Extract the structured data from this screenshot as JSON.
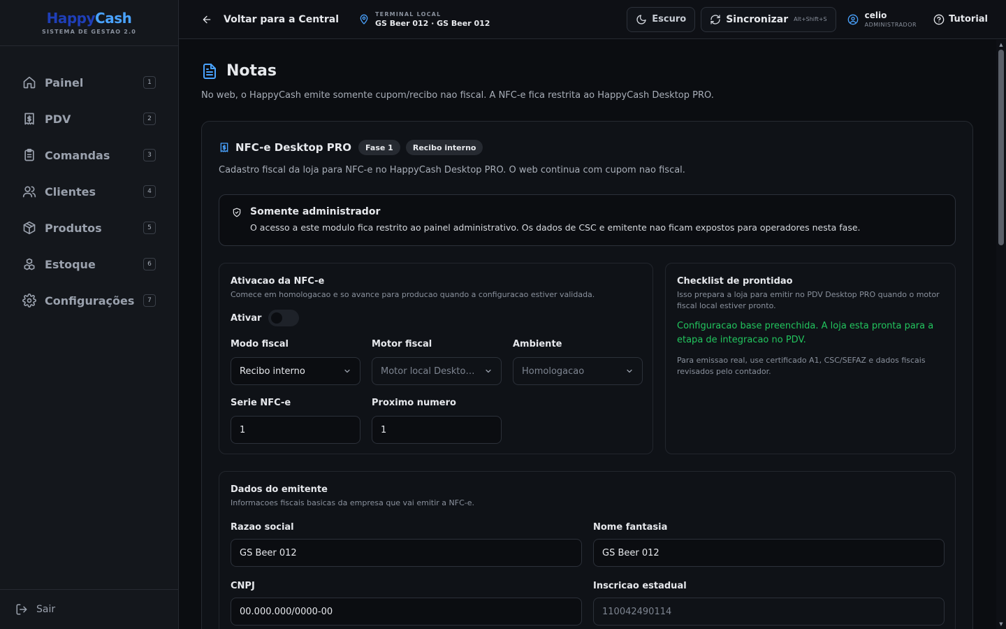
{
  "brand": {
    "happy": "Happy",
    "cash": "Cash",
    "subtitle": "SISTEMA DE GESTAO 2.0"
  },
  "sidebar": {
    "items": [
      {
        "label": "Painel",
        "key": "1",
        "icon": "home-icon"
      },
      {
        "label": "PDV",
        "key": "2",
        "icon": "receipt-icon"
      },
      {
        "label": "Comandas",
        "key": "3",
        "icon": "clipboard-icon"
      },
      {
        "label": "Clientes",
        "key": "4",
        "icon": "users-icon"
      },
      {
        "label": "Produtos",
        "key": "5",
        "icon": "package-icon"
      },
      {
        "label": "Estoque",
        "key": "6",
        "icon": "boxes-icon"
      },
      {
        "label": "Configurações",
        "key": "7",
        "icon": "gear-icon"
      }
    ],
    "logout": "Sair"
  },
  "header": {
    "back": "Voltar para a Central",
    "terminal_label": "TERMINAL LOCAL",
    "terminal_value": "GS Beer 012 · GS Beer 012",
    "theme": "Escuro",
    "sync": "Sincronizar",
    "sync_shortcut": "Alt+Shift+S",
    "user_name": "celio",
    "user_role": "ADMINISTRADOR",
    "tutorial": "Tutorial"
  },
  "page": {
    "title": "Notas",
    "description": "No web, o HappyCash emite somente cupom/recibo nao fiscal. A NFC-e fica restrita ao HappyCash Desktop PRO."
  },
  "card": {
    "title": "NFC-e Desktop PRO",
    "badge_phase": "Fase 1",
    "badge_mode": "Recibo interno",
    "description": "Cadastro fiscal da loja para NFC-e no HappyCash Desktop PRO. O web continua com cupom nao fiscal.",
    "alert_title": "Somente administrador",
    "alert_text": "O acesso a este modulo fica restrito ao painel administrativo. Os dados de CSC e emitente nao ficam expostos para operadores nesta fase."
  },
  "activation": {
    "title": "Ativacao da NFC-e",
    "subtitle": "Comece em homologacao e so avance para producao quando a configuracao estiver validada.",
    "toggle_label": "Ativar",
    "toggle_on": false,
    "modo_label": "Modo fiscal",
    "modo_value": "Recibo interno",
    "motor_label": "Motor fiscal",
    "motor_value": "Motor local Desktop PRO",
    "ambiente_label": "Ambiente",
    "ambiente_value": "Homologacao",
    "serie_label": "Serie NFC-e",
    "serie_value": "1",
    "numero_label": "Proximo numero",
    "numero_value": "1"
  },
  "checklist": {
    "title": "Checklist de prontidao",
    "subtitle": "Isso prepara a loja para emitir no PDV Desktop PRO quando o motor fiscal local estiver pronto.",
    "status": "Configuracao base preenchida. A loja esta pronta para a etapa de integracao no PDV.",
    "note": "Para emissao real, use certificado A1, CSC/SEFAZ e dados fiscais revisados pelo contador."
  },
  "emitente": {
    "title": "Dados do emitente",
    "subtitle": "Informacoes fiscais basicas da empresa que vai emitir a NFC-e.",
    "razao_label": "Razao social",
    "razao_value": "GS Beer 012",
    "fantasia_label": "Nome fantasia",
    "fantasia_value": "GS Beer 012",
    "cnpj_label": "CNPJ",
    "cnpj_value": "00.000.000/0000-00",
    "ie_label": "Inscricao estadual",
    "ie_placeholder": "110042490114"
  },
  "colors": {
    "accent": "#4aa3ff",
    "success": "#22c55e",
    "background": "#0b0d11"
  }
}
